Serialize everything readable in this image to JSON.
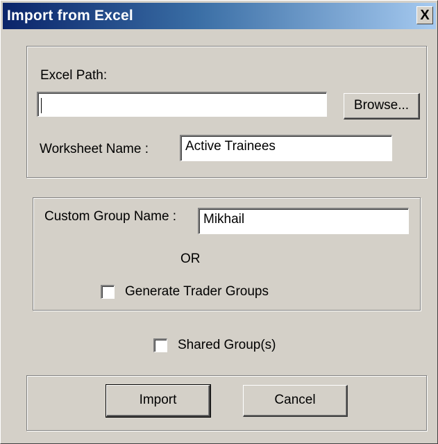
{
  "window": {
    "title": "Import from Excel",
    "close_glyph": "X"
  },
  "excel_group": {
    "path_label": "Excel Path:",
    "path_value": "",
    "browse_label": "Browse...",
    "worksheet_label": "Worksheet Name :",
    "worksheet_value": "Active Trainees"
  },
  "custom_group": {
    "name_label": "Custom Group Name :",
    "name_value": "Mikhail",
    "or_label": "OR",
    "generate_label": "Generate Trader Groups",
    "generate_checked": false
  },
  "shared": {
    "label": "Shared Group(s)",
    "checked": false
  },
  "footer": {
    "import_label": "Import",
    "cancel_label": "Cancel"
  }
}
